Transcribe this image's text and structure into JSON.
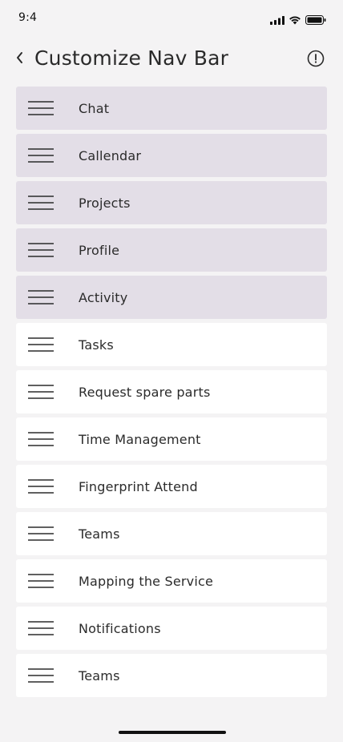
{
  "status_bar": {
    "time": "9:4",
    "icons": [
      "cellular-signal-icon",
      "wifi-icon",
      "battery-icon"
    ]
  },
  "header": {
    "title": "Customize Nav Bar",
    "back_icon": "chevron-left-icon",
    "info_icon": "info-circle-icon"
  },
  "colors": {
    "active_item_bg": "#e3dee7",
    "inactive_item_bg": "#ffffff",
    "page_bg": "#f4f3f4"
  },
  "nav_items": [
    {
      "label": "Chat",
      "active": true
    },
    {
      "label": "Callendar",
      "active": true
    },
    {
      "label": "Projects",
      "active": true
    },
    {
      "label": "Profile",
      "active": true
    },
    {
      "label": "Activity",
      "active": true
    },
    {
      "label": "Tasks",
      "active": false
    },
    {
      "label": "Request spare parts",
      "active": false
    },
    {
      "label": "Time Management",
      "active": false
    },
    {
      "label": "Fingerprint Attend",
      "active": false
    },
    {
      "label": "Teams",
      "active": false
    },
    {
      "label": "Mapping the Service",
      "active": false
    },
    {
      "label": "Notifications",
      "active": false
    },
    {
      "label": "Teams",
      "active": false
    }
  ]
}
